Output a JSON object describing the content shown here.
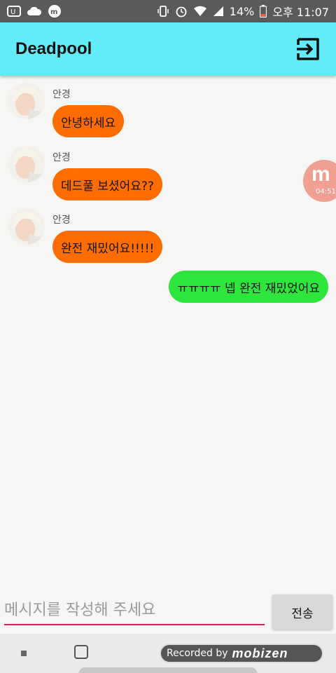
{
  "status_bar": {
    "battery": "14%",
    "time": "오후 11:07"
  },
  "app_bar": {
    "title": "Deadpool",
    "exit_icon": "exit-to-app-icon"
  },
  "messages": [
    {
      "direction": "in",
      "sender": "안경",
      "text": "안녕하세요"
    },
    {
      "direction": "in",
      "sender": "안경",
      "text": "데드풀 보셨어요??"
    },
    {
      "direction": "in",
      "sender": "안경",
      "text": "완전 재밌어요!!!!!"
    },
    {
      "direction": "out",
      "text": "ㅠㅠㅠㅠ 넵 완전 재밌었어요"
    }
  ],
  "floating_badge": {
    "letter": "m",
    "timer": "04:51"
  },
  "composer": {
    "placeholder": "메시지를 작성해 주세요",
    "value": "",
    "send_label": "전송"
  },
  "nav_bar": {
    "recorded_label": "Recorded by",
    "recorded_brand": "mobizen"
  },
  "colors": {
    "app_bar": "#63ecf8",
    "incoming_bubble": "#ff6d00",
    "outgoing_bubble": "#2ee53b",
    "input_underline": "#d81b60"
  }
}
